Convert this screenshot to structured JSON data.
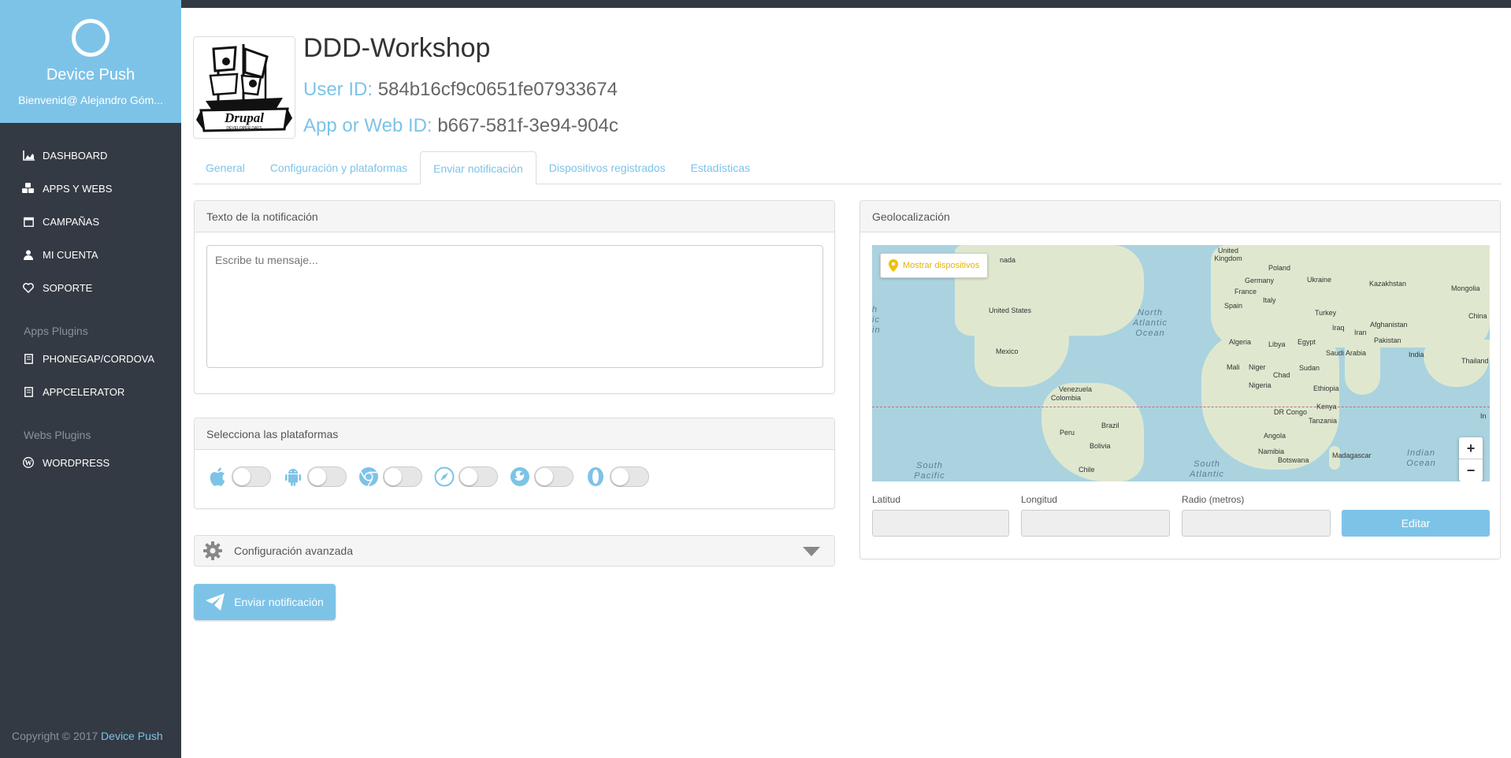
{
  "sidebar": {
    "brand_name": "Device Push",
    "welcome": "Bienvenid@ Alejandro Góm...",
    "items": [
      {
        "label": "DASHBOARD",
        "icon": "chart-icon"
      },
      {
        "label": "APPS Y WEBS",
        "icon": "cubes-icon"
      },
      {
        "label": "CAMPAÑAS",
        "icon": "calendar-icon"
      },
      {
        "label": "MI CUENTA",
        "icon": "user-icon"
      },
      {
        "label": "SOPORTE",
        "icon": "heart-icon"
      }
    ],
    "apps_plugins_title": "Apps Plugins",
    "apps_plugins": [
      {
        "label": "PHONEGAP/CORDOVA",
        "icon": "book-icon"
      },
      {
        "label": "APPCELERATOR",
        "icon": "book-icon"
      }
    ],
    "webs_plugins_title": "Webs Plugins",
    "webs_plugins": [
      {
        "label": "WORDPRESS",
        "icon": "wordpress-icon"
      }
    ],
    "copyright_prefix": "Copyright © 2017",
    "copyright_link": "Device Push"
  },
  "header": {
    "app_name": "DDD-Workshop",
    "user_id_label": "User ID:",
    "user_id": "584b16cf9c0651fe07933674",
    "app_id_label": "App or Web ID:",
    "app_id": "b667-581f-3e94-904c",
    "logo_text": "Drupal",
    "logo_subtext": "DEVELOPER DAYS"
  },
  "tabs": [
    {
      "label": "General",
      "active": false
    },
    {
      "label": "Configuración y plataformas",
      "active": false
    },
    {
      "label": "Enviar notificación",
      "active": true
    },
    {
      "label": "Dispositivos registrados",
      "active": false
    },
    {
      "label": "Estadísticas",
      "active": false
    }
  ],
  "notification": {
    "heading": "Texto de la notificación",
    "placeholder": "Escribe tu mensaje..."
  },
  "platforms": {
    "heading": "Selecciona las plataformas",
    "items": [
      {
        "name": "apple-icon",
        "enabled": false
      },
      {
        "name": "android-icon",
        "enabled": false
      },
      {
        "name": "chrome-icon",
        "enabled": false
      },
      {
        "name": "safari-icon",
        "enabled": false
      },
      {
        "name": "firefox-icon",
        "enabled": false
      },
      {
        "name": "opera-icon",
        "enabled": false
      }
    ]
  },
  "advanced": {
    "label": "Configuración avanzada"
  },
  "send_button": {
    "label": "Enviar notificación"
  },
  "geo": {
    "heading": "Geolocalización",
    "show_devices": "Mostrar dispositivos",
    "latitude_label": "Latitud",
    "longitude_label": "Longitud",
    "radius_label": "Radio (metros)",
    "edit_label": "Editar",
    "zoom_in": "+",
    "zoom_out": "−",
    "map_labels": {
      "canada": "nada",
      "united_kingdom": "United Kingdom",
      "poland": "Poland",
      "ukraine": "Ukraine",
      "germany": "Germany",
      "france": "France",
      "kazakhstan": "Kazakhstan",
      "mongolia": "Mongolia",
      "spain": "Spain",
      "italy": "Italy",
      "united_states": "United States",
      "north_atlantic": "North Atlantic Ocean",
      "turkey": "Turkey",
      "china": "China",
      "afghanistan": "Afghanistan",
      "iraq": "Iraq",
      "iran": "Iran",
      "algeria": "Algeria",
      "libya": "Libya",
      "egypt": "Egypt",
      "saudi_arabia": "Saudi Arabia",
      "pakistan": "Pakistan",
      "india": "India",
      "thailand": "Thailand",
      "mexico": "Mexico",
      "mali": "Mali",
      "niger": "Niger",
      "chad": "Chad",
      "sudan": "Sudan",
      "venezuela": "Venezuela",
      "colombia": "Colombia",
      "nigeria": "Nigeria",
      "ethiopia": "Ethiopia",
      "dr_congo": "DR Congo",
      "kenya": "Kenya",
      "tanzania": "Tanzania",
      "peru": "Peru",
      "brazil": "Brazil",
      "bolivia": "Bolivia",
      "angola": "Angola",
      "namibia": "Namibia",
      "botswana": "Botswana",
      "madagascar": "Madagascar",
      "indian_ocean": "Indian Ocean",
      "chile": "Chile",
      "south_pacific": "South Pacific",
      "south_atlantic": "South Atlantic",
      "left_edge_fragment": "h ic in",
      "right_edge_fragment": "In"
    }
  }
}
